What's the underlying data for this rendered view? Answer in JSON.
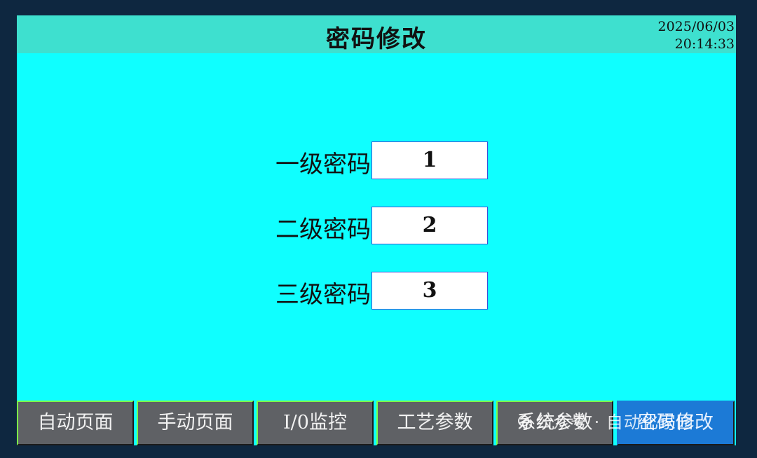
{
  "header": {
    "title": "密码修改",
    "date": "2025/06/03",
    "time": "20:14:33"
  },
  "passwords": [
    {
      "label": "一级密码",
      "value": "1"
    },
    {
      "label": "二级密码",
      "value": "2"
    },
    {
      "label": "三级密码",
      "value": "3"
    }
  ],
  "nav": {
    "items": [
      {
        "label": "自动页面"
      },
      {
        "label": "手动页面"
      },
      {
        "label": "I/0监控"
      },
      {
        "label": "工艺参数"
      },
      {
        "label": "系统参数"
      },
      {
        "label": "密码修改"
      }
    ],
    "active_index": 5
  },
  "watermark": {
    "text": "公众号 · 自动化家园"
  },
  "colors": {
    "screen_bg": "#0fffff",
    "title_bar": "#3ee0cf",
    "nav_button": "#5f6165",
    "nav_active": "#1c7ad6",
    "nav_highlight": "#7cff4a"
  }
}
